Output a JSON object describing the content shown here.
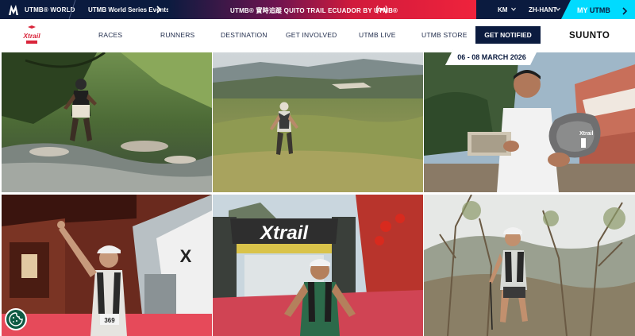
{
  "topbar": {
    "utmb_world": "UTMB® WORLD",
    "world_series": "UTMB World Series Events",
    "live_banner": "UTMB® 實時追蹤 QUITO TRAIL ECUADOR BY UTMB®",
    "unit": "KM",
    "language": "ZH-HANT",
    "my_utmb_prefix": "MY ",
    "my_utmb_brand": "UTMB"
  },
  "nav": {
    "items": [
      "RACES",
      "RUNNERS",
      "DESTINATION",
      "GET INVOLVED",
      "UTMB LIVE",
      "UTMB STORE"
    ],
    "cta": "GET NOTIFIED",
    "partner": "SUUNTO",
    "event_logo": "Xtrail"
  },
  "event": {
    "dates": "06 - 08 MARCH 2026"
  },
  "photos": [
    {
      "name": "runner-forest-stream"
    },
    {
      "name": "runner-grassland-valley"
    },
    {
      "name": "finisher-with-trophy"
    },
    {
      "name": "runner-celebrating-finish"
    },
    {
      "name": "runner-finish-arch",
      "banner": "Xtrail"
    },
    {
      "name": "runner-trail-dry-trees"
    }
  ],
  "colors": {
    "navy": "#0b1b3f",
    "cyan": "#00dbff",
    "red": "#ef233c",
    "cookie": "#0e5a43"
  },
  "icons": [
    "utmb-logo-icon",
    "chevron-right-icon",
    "live-broadcast-icon",
    "chevron-down-icon",
    "cookie-icon"
  ]
}
